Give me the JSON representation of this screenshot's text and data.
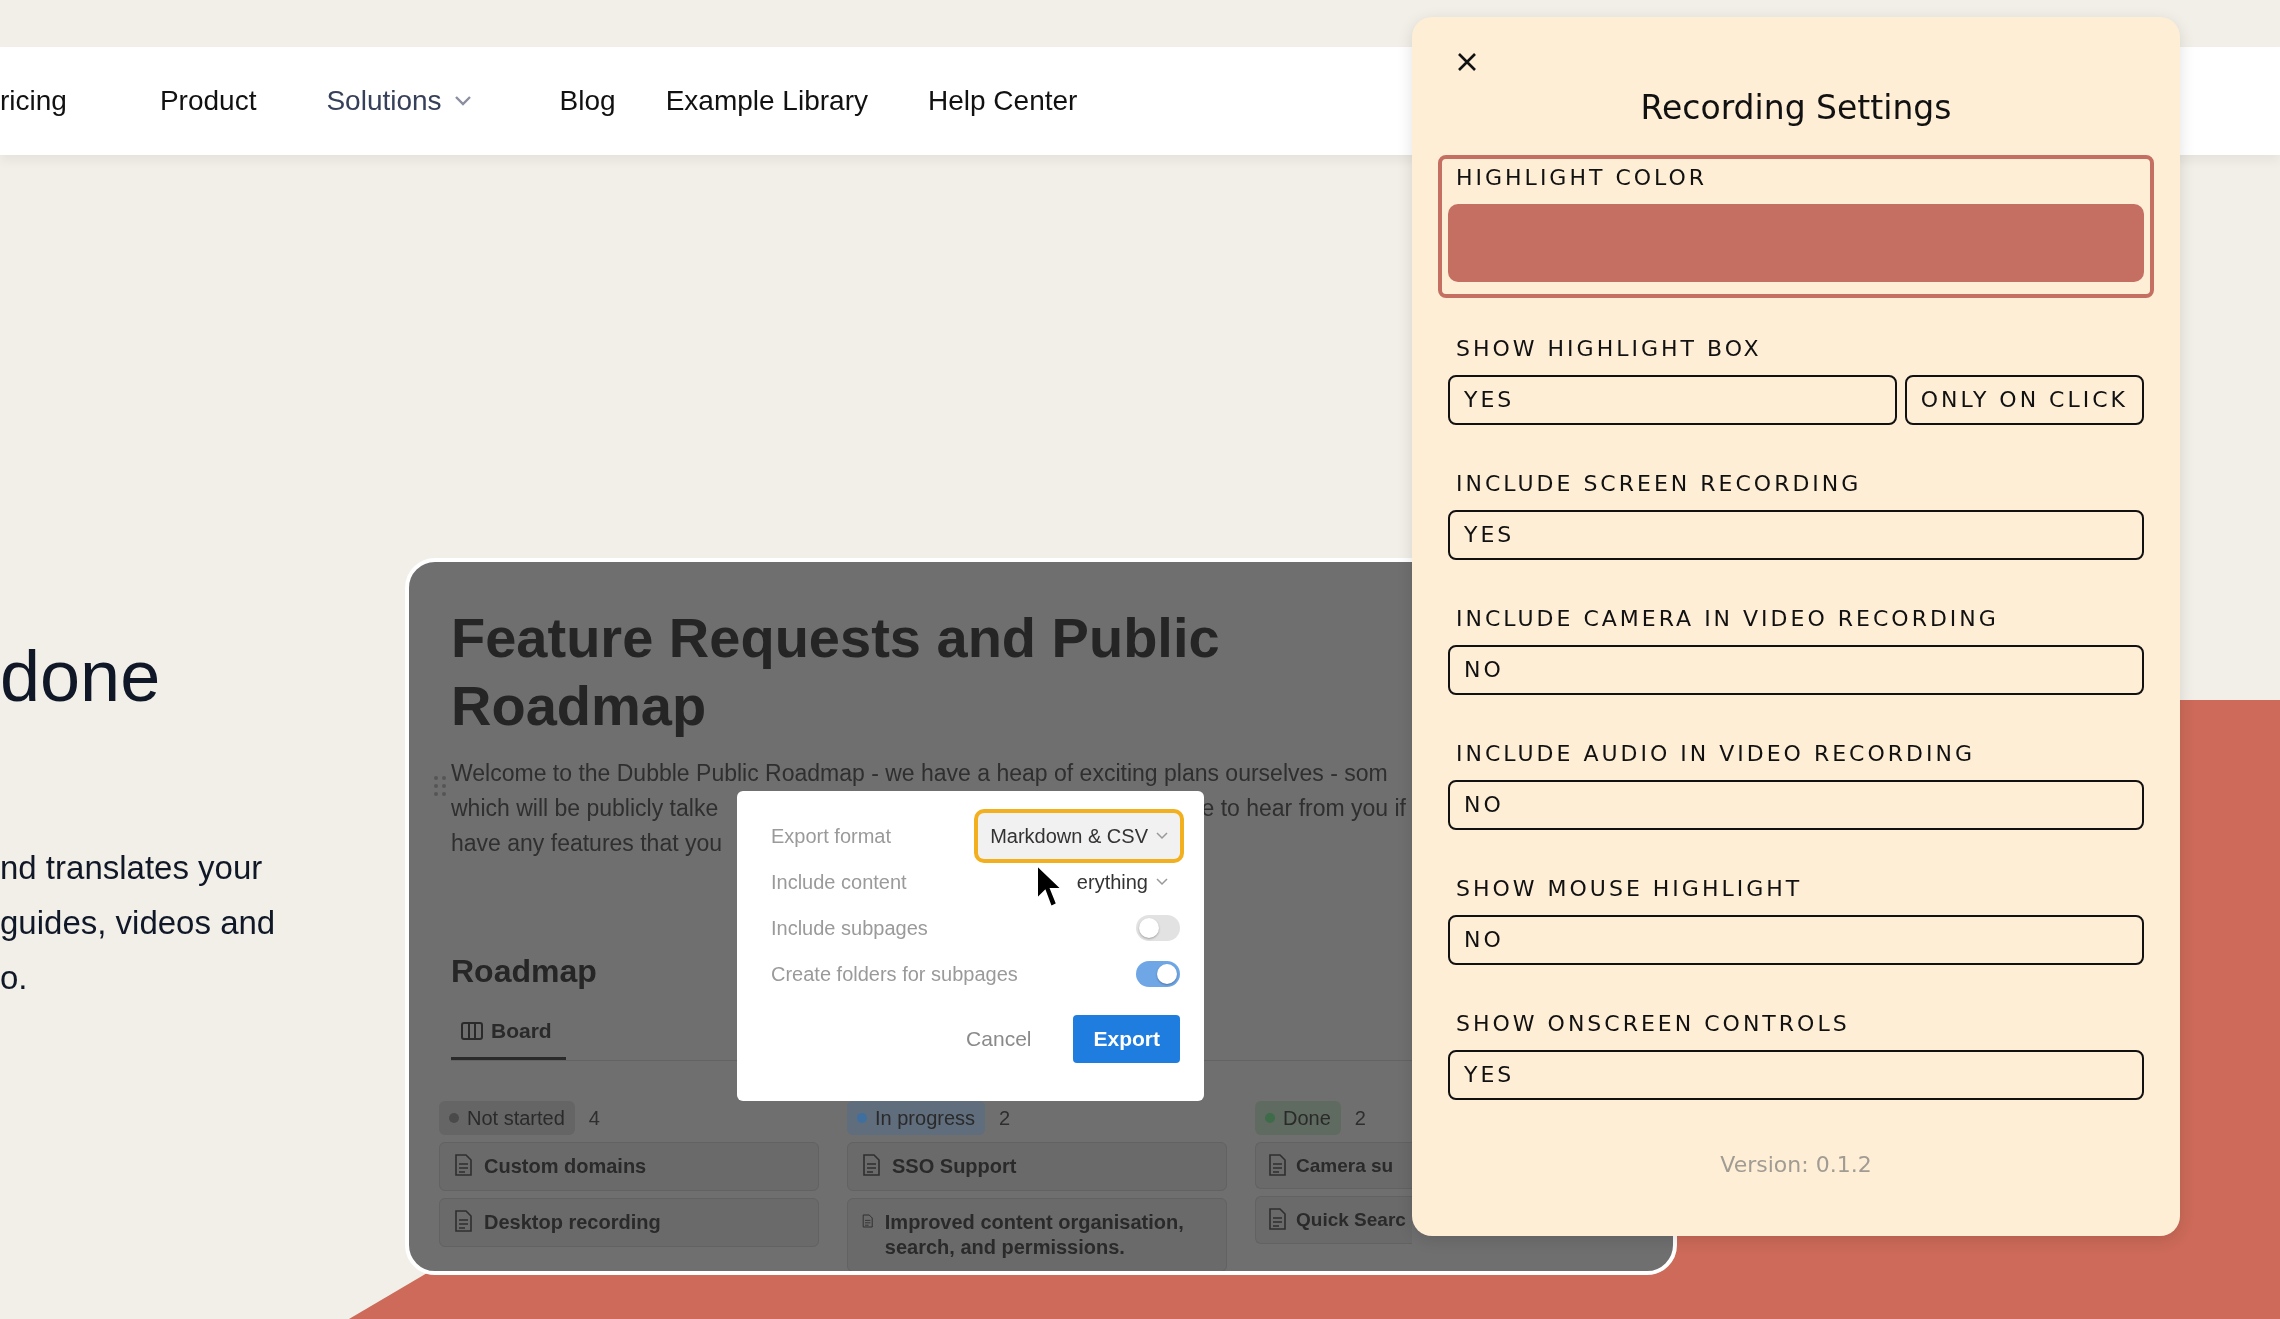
{
  "nav": {
    "items": [
      {
        "label": "ricing",
        "dropdown": false
      },
      {
        "label": "Product",
        "dropdown": false
      },
      {
        "label": "Solutions",
        "dropdown": true
      },
      {
        "label": "Blog",
        "dropdown": false
      },
      {
        "label": "Example Library",
        "dropdown": false
      },
      {
        "label": "Help Center",
        "dropdown": false
      }
    ]
  },
  "hero": {
    "heading": "done",
    "paragraph_lines": [
      "nd translates your",
      "guides, videos and",
      "o."
    ]
  },
  "screenshot": {
    "title": "Feature Requests and Public Roadmap",
    "description_lines": [
      [
        "Welcome to the Dubble Public Roadmap - we have a heap of exciting plans ourselves - som"
      ],
      [
        "which will be publicly talke",
        "e to hear from you if"
      ],
      [
        "have any features that you"
      ]
    ],
    "dialog": {
      "rows": [
        {
          "kind": "select",
          "label": "Export format",
          "value": "Markdown & CSV",
          "focused": true
        },
        {
          "kind": "select",
          "label": "Include content",
          "value": "erything",
          "focused": false
        },
        {
          "kind": "toggle",
          "label": "Include subpages",
          "on": false
        },
        {
          "kind": "toggle",
          "label": "Create folders for subpages",
          "on": true
        }
      ],
      "buttons": [
        {
          "label": "Cancel",
          "primary": false
        },
        {
          "label": "Export",
          "primary": true
        }
      ]
    },
    "roadmap_heading": "Roadmap",
    "view_tab": "Board",
    "columns": [
      {
        "status": "Not started",
        "count": "4",
        "color": "#4a4a4a",
        "cards": [
          "Custom domains",
          "Desktop recording"
        ]
      },
      {
        "status": "In progress",
        "count": "2",
        "color": "#3f6f9e",
        "cards": [
          "SSO Support",
          "Improved content organisation, search, and permissions."
        ]
      },
      {
        "status": "Done",
        "count": "2",
        "color": "#3e6b48",
        "cards": [
          "Camera su",
          "Quick Searc"
        ]
      }
    ]
  },
  "panel": {
    "title": "Recording Settings",
    "settings": [
      {
        "kind": "color",
        "label": "HIGHLIGHT COLOR",
        "color": "#c56f62",
        "focused": true
      },
      {
        "kind": "choice",
        "label": "SHOW HIGHLIGHT BOX",
        "options": [
          "YES",
          "ONLY ON CLICK"
        ]
      },
      {
        "kind": "choice",
        "label": "INCLUDE SCREEN RECORDING",
        "options": [
          "YES"
        ]
      },
      {
        "kind": "choice",
        "label": "INCLUDE CAMERA IN VIDEO RECORDING",
        "options": [
          "NO"
        ]
      },
      {
        "kind": "choice",
        "label": "INCLUDE AUDIO IN VIDEO RECORDING",
        "options": [
          "NO"
        ]
      },
      {
        "kind": "choice",
        "label": "SHOW MOUSE HIGHLIGHT",
        "options": [
          "NO"
        ]
      },
      {
        "kind": "choice",
        "label": "SHOW ONSCREEN CONTROLS",
        "options": [
          "YES"
        ]
      }
    ],
    "version": "Version: 0.1.2"
  }
}
